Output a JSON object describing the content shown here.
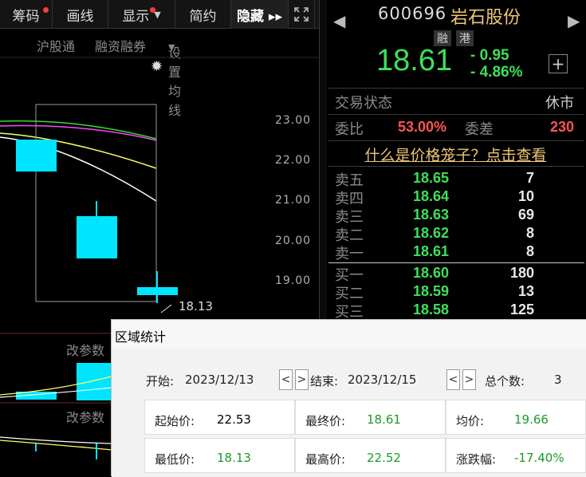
{
  "toolbar": {
    "items": [
      {
        "label": "筹码"
      },
      {
        "label": "画线"
      },
      {
        "label": "显示"
      },
      {
        "label": "简约"
      },
      {
        "label": "隐藏 ▸▸"
      }
    ],
    "fullscreen_icon": "expand-icon"
  },
  "subbar": {
    "hk_connect": "沪股通",
    "margin": "融资融券",
    "ma_setting": "设置均线"
  },
  "chart": {
    "price_ticks": [
      "23.00",
      "22.00",
      "21.00",
      "20.00",
      "19.00"
    ],
    "low_annotation": "18.13",
    "indicator_label_1": "改参数",
    "indicator_label_2": "改参数",
    "colors": {
      "up": "#00e5ff",
      "ma5": "#ffffff",
      "ma10": "#ffff66",
      "ma20": "#ff44ff",
      "ma30": "#33dd33"
    }
  },
  "quote": {
    "code": "600696",
    "name": "岩石股份",
    "badge_rong": "融",
    "badge_gang": "港",
    "price": "18.61",
    "change": "- 0.95",
    "change_pct": "- 4.86%",
    "trade_status_label": "交易状态",
    "trade_status_value": "休市",
    "ratio_label": "委比",
    "ratio_value": "53.00%",
    "diff_label": "委差",
    "diff_value": "230",
    "cage_link": "什么是价格笼子？点击查看"
  },
  "orderbook": {
    "asks": [
      {
        "label": "卖五",
        "price": "18.65",
        "vol": "7"
      },
      {
        "label": "卖四",
        "price": "18.64",
        "vol": "10"
      },
      {
        "label": "卖三",
        "price": "18.63",
        "vol": "69"
      },
      {
        "label": "卖二",
        "price": "18.62",
        "vol": "8"
      },
      {
        "label": "卖一",
        "price": "18.61",
        "vol": "8"
      }
    ],
    "bids": [
      {
        "label": "买一",
        "price": "18.60",
        "vol": "180"
      },
      {
        "label": "买二",
        "price": "18.59",
        "vol": "13"
      },
      {
        "label": "买三",
        "price": "18.58",
        "vol": "125"
      }
    ]
  },
  "dialog": {
    "title": "区域统计",
    "start_label": "开始:",
    "start_value": "2023/12/13",
    "end_label": "结束:",
    "end_value": "2023/12/15",
    "count_label": "总个数:",
    "count_value": "3",
    "prev": "<",
    "next": ">",
    "stats": [
      {
        "label": "起始价:",
        "value": "22.53",
        "color": "#000000"
      },
      {
        "label": "最终价:",
        "value": "18.61",
        "color": "#1a9a2a"
      },
      {
        "label": "均价:",
        "value": "19.66",
        "color": "#1a9a2a"
      },
      {
        "label": "最低价:",
        "value": "18.13",
        "color": "#1a9a2a"
      },
      {
        "label": "最高价:",
        "value": "22.52",
        "color": "#1a9a2a"
      },
      {
        "label": "涨跌幅:",
        "value": "-17.40%",
        "color": "#1a9a2a"
      }
    ]
  }
}
